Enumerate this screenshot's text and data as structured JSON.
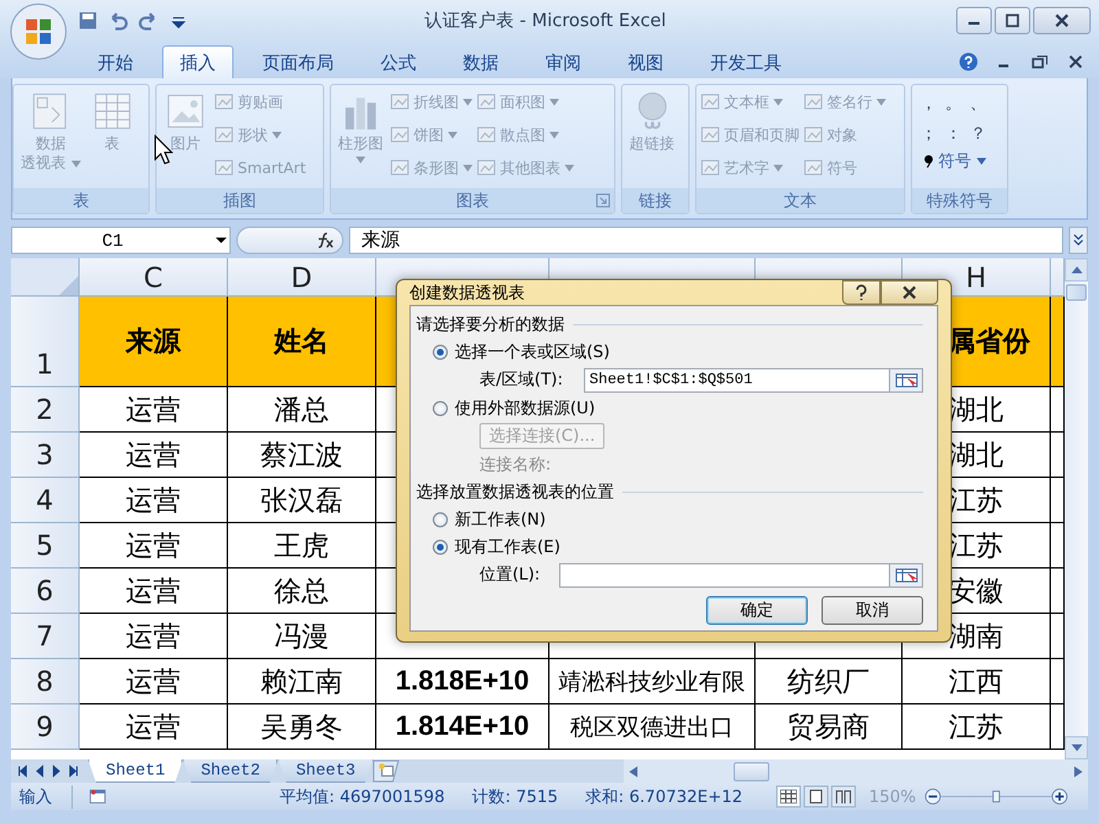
{
  "window": {
    "title": "认证客户表 - Microsoft Excel"
  },
  "ribbon_tabs": [
    {
      "label": "开始",
      "selected": false
    },
    {
      "label": "插入",
      "selected": true
    },
    {
      "label": "页面布局",
      "selected": false
    },
    {
      "label": "公式",
      "selected": false
    },
    {
      "label": "数据",
      "selected": false
    },
    {
      "label": "审阅",
      "selected": false
    },
    {
      "label": "视图",
      "selected": false
    },
    {
      "label": "开发工具",
      "selected": false
    }
  ],
  "ribbon_groups": [
    {
      "label": "表",
      "columns": [
        [
          {
            "kind": "large",
            "lines": [
              "数据",
              "透视表"
            ],
            "dropdown": true
          }
        ],
        [
          {
            "kind": "large",
            "lines": [
              "表"
            ],
            "dropdown": false
          }
        ]
      ]
    },
    {
      "label": "插图",
      "columns": [
        [
          {
            "kind": "large",
            "lines": [
              "图片"
            ],
            "dropdown": false
          }
        ],
        [
          {
            "kind": "small",
            "lines": [
              "剪贴画"
            ],
            "dropdown": false
          },
          {
            "kind": "small",
            "lines": [
              "形状"
            ],
            "dropdown": true
          },
          {
            "kind": "small",
            "lines": [
              "SmartArt"
            ],
            "dropdown": false
          }
        ]
      ]
    },
    {
      "label": "图表",
      "launcher": true,
      "columns": [
        [
          {
            "kind": "large",
            "lines": [
              "柱形图"
            ],
            "dropdown": true
          }
        ],
        [
          {
            "kind": "small",
            "lines": [
              "折线图"
            ],
            "dropdown": true
          },
          {
            "kind": "small",
            "lines": [
              "饼图"
            ],
            "dropdown": true
          },
          {
            "kind": "small",
            "lines": [
              "条形图"
            ],
            "dropdown": true
          }
        ],
        [
          {
            "kind": "small",
            "lines": [
              "面积图"
            ],
            "dropdown": true
          },
          {
            "kind": "small",
            "lines": [
              "散点图"
            ],
            "dropdown": true
          },
          {
            "kind": "small",
            "lines": [
              "其他图表"
            ],
            "dropdown": true
          }
        ]
      ]
    },
    {
      "label": "链接",
      "columns": [
        [
          {
            "kind": "large",
            "lines": [
              "超链接"
            ],
            "dropdown": false
          }
        ]
      ]
    },
    {
      "label": "文本",
      "columns": [
        [
          {
            "kind": "small",
            "lines": [
              "文本框"
            ],
            "dropdown": true
          },
          {
            "kind": "small",
            "lines": [
              "页眉和页脚"
            ],
            "dropdown": false
          },
          {
            "kind": "small",
            "lines": [
              "艺术字"
            ],
            "dropdown": true
          }
        ],
        [
          {
            "kind": "small",
            "lines": [
              "签名行"
            ],
            "dropdown": true
          },
          {
            "kind": "small",
            "lines": [
              "对象"
            ],
            "dropdown": false
          },
          {
            "kind": "small",
            "lines": [
              "符号"
            ],
            "dropdown": false
          }
        ]
      ]
    },
    {
      "label": "特殊符号",
      "symbols": [
        "，",
        "。",
        "、",
        "；",
        "：",
        "？"
      ],
      "columns": [
        [
          {
            "kind": "small",
            "lines": [
              "符号"
            ],
            "dropdown": true
          }
        ]
      ]
    }
  ],
  "formula_bar": {
    "name_box": "C1",
    "content": "来源"
  },
  "grid": {
    "columns": [
      "C",
      "D",
      null,
      null,
      null,
      "H"
    ],
    "rows": [
      {
        "number": "1",
        "kind": "header",
        "cells": [
          "来源",
          "姓名",
          null,
          null,
          null,
          "属省份"
        ]
      },
      {
        "number": "2",
        "kind": "data",
        "cells": [
          "运营",
          "潘总",
          null,
          null,
          null,
          "湖北"
        ]
      },
      {
        "number": "3",
        "kind": "data",
        "cells": [
          "运营",
          "蔡江波",
          null,
          null,
          null,
          "湖北"
        ]
      },
      {
        "number": "4",
        "kind": "data",
        "cells": [
          "运营",
          "张汉磊",
          null,
          null,
          null,
          "江苏"
        ]
      },
      {
        "number": "5",
        "kind": "data",
        "cells": [
          "运营",
          "王虎",
          null,
          null,
          null,
          "江苏"
        ]
      },
      {
        "number": "6",
        "kind": "data",
        "cells": [
          "运营",
          "徐总",
          null,
          null,
          null,
          "安徽"
        ]
      },
      {
        "number": "7",
        "kind": "data",
        "cells": [
          "运营",
          "冯漫",
          null,
          null,
          null,
          "湖南"
        ]
      },
      {
        "number": "8",
        "kind": "data",
        "cells": [
          "运营",
          "赖江南",
          "1.818E+10",
          "靖淞科技纱业有限",
          "纺织厂",
          "江西"
        ]
      },
      {
        "number": "9",
        "kind": "data",
        "cells": [
          "运营",
          "吴勇冬",
          "1.814E+10",
          "税区双德进出口",
          "贸易商",
          "江苏"
        ]
      }
    ]
  },
  "sheet_tabs": [
    {
      "label": "Sheet1",
      "selected": true
    },
    {
      "label": "Sheet2",
      "selected": false
    },
    {
      "label": "Sheet3",
      "selected": false
    }
  ],
  "status_bar": {
    "mode": "输入",
    "stats": [
      "平均值: 4697001598",
      "计数: 7515",
      "求和: 6.70732E+12"
    ],
    "zoom": "150%",
    "zoom_slider": {
      "level": 0.5
    }
  },
  "dialog": {
    "title": "创建数据透视表",
    "sections": [
      {
        "heading": "请选择要分析的数据",
        "options": [
          {
            "label": "选择一个表或区域(S)",
            "selected": true,
            "field": {
              "label": "表/区域(T):",
              "value": "Sheet1!$C$1:$Q$501"
            }
          },
          {
            "label": "使用外部数据源(U)",
            "selected": false,
            "button": {
              "label": "选择连接(C)...",
              "disabled": true
            },
            "note": {
              "label": "连接名称:",
              "disabled": true
            }
          }
        ]
      },
      {
        "heading": "选择放置数据透视表的位置",
        "options": [
          {
            "label": "新工作表(N)",
            "selected": false
          },
          {
            "label": "现有工作表(E)",
            "selected": true,
            "field": {
              "label": "位置(L):"
            }
          }
        ]
      }
    ],
    "buttons": [
      {
        "label": "确定",
        "default": true
      },
      {
        "label": "取消",
        "default": false
      }
    ]
  }
}
